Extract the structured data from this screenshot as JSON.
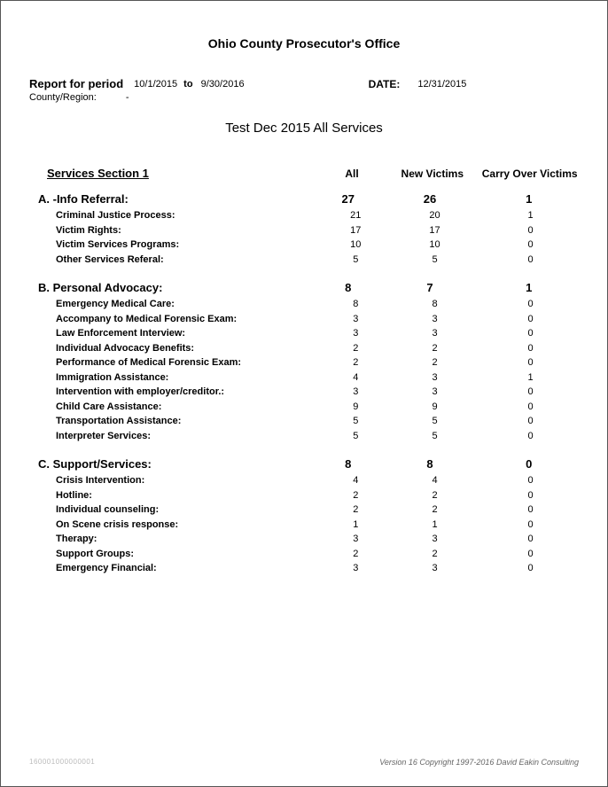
{
  "header": {
    "title": "Ohio County Prosecutor's Office",
    "period_label": "Report for period",
    "period_from": "10/1/2015",
    "period_to_label": "to",
    "period_to": "9/30/2016",
    "date_label": "DATE:",
    "date_value": "12/31/2015",
    "county_label": "County/Region:",
    "county_value": "-",
    "subtitle": "Test Dec 2015  All Services"
  },
  "columns": {
    "section": "Services Section 1",
    "all": "All",
    "new": "New Victims",
    "carry": "Carry Over Victims"
  },
  "sections": [
    {
      "title": "A. -Info Referral:",
      "all": "27",
      "new": "26",
      "carry": "1",
      "items": [
        {
          "label": "Criminal Justice Process:",
          "all": "21",
          "new": "20",
          "carry": "1"
        },
        {
          "label": "Victim Rights:",
          "all": "17",
          "new": "17",
          "carry": "0"
        },
        {
          "label": "Victim Services Programs:",
          "all": "10",
          "new": "10",
          "carry": "0"
        },
        {
          "label": "Other Services Referal:",
          "all": "5",
          "new": "5",
          "carry": "0"
        }
      ]
    },
    {
      "title": "B. Personal Advocacy:",
      "all": "8",
      "new": "7",
      "carry": "1",
      "items": [
        {
          "label": "Emergency Medical Care:",
          "all": "8",
          "new": "8",
          "carry": "0"
        },
        {
          "label": "Accompany to Medical Forensic Exam:",
          "all": "3",
          "new": "3",
          "carry": "0"
        },
        {
          "label": "Law Enforcement Interview:",
          "all": "3",
          "new": "3",
          "carry": "0"
        },
        {
          "label": "Individual Advocacy Benefits:",
          "all": "2",
          "new": "2",
          "carry": "0"
        },
        {
          "label": "Performance of Medical Forensic Exam:",
          "all": "2",
          "new": "2",
          "carry": "0"
        },
        {
          "label": "Immigration Assistance:",
          "all": "4",
          "new": "3",
          "carry": "1"
        },
        {
          "label": "Intervention with employer/creditor.:",
          "all": "3",
          "new": "3",
          "carry": "0"
        },
        {
          "label": "Child Care Assistance:",
          "all": "9",
          "new": "9",
          "carry": "0"
        },
        {
          "label": "Transportation Assistance:",
          "all": "5",
          "new": "5",
          "carry": "0"
        },
        {
          "label": "Interpreter Services:",
          "all": "5",
          "new": "5",
          "carry": "0"
        }
      ]
    },
    {
      "title": "C. Support/Services:",
      "all": "8",
      "new": "8",
      "carry": "0",
      "items": [
        {
          "label": "Crisis Intervention:",
          "all": "4",
          "new": "4",
          "carry": "0"
        },
        {
          "label": "Hotline:",
          "all": "2",
          "new": "2",
          "carry": "0"
        },
        {
          "label": "Individual counseling:",
          "all": "2",
          "new": "2",
          "carry": "0"
        },
        {
          "label": "On Scene crisis response:",
          "all": "1",
          "new": "1",
          "carry": "0"
        },
        {
          "label": "Therapy:",
          "all": "3",
          "new": "3",
          "carry": "0"
        },
        {
          "label": "Support Groups:",
          "all": "2",
          "new": "2",
          "carry": "0"
        },
        {
          "label": "Emergency Financial:",
          "all": "3",
          "new": "3",
          "carry": "0"
        }
      ]
    }
  ],
  "footer": {
    "left": "160001000000001",
    "right": "Version 16  Copyright 1997-2016 David Eakin Consulting"
  }
}
